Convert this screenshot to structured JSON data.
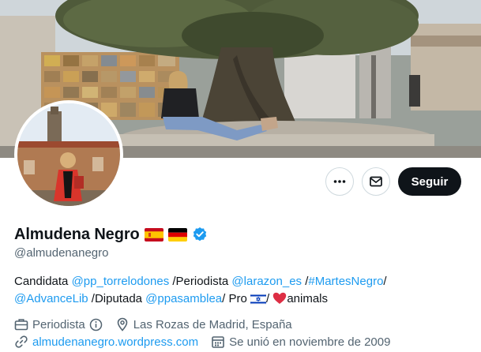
{
  "profile": {
    "name": "Almudena Negro",
    "handle": "@almudenanegro",
    "verified": true,
    "name_flags": [
      "flag-spain",
      "flag-germany"
    ]
  },
  "actions": {
    "more_icon": "more-dots-icon",
    "message_icon": "mail-icon",
    "follow_label": "Seguir"
  },
  "bio": {
    "t1": "Candidata ",
    "l1": "@pp_torrelodones",
    "t2": " /Periodista ",
    "l2": "@larazon_es",
    "t3": " /",
    "l3": "#MartesNegro",
    "t4": "/",
    "l4": "@AdvanceLib",
    "t5": " /Diputada ",
    "l5": "@ppasamblea",
    "t6": "/ Pro ",
    "t7": "/ ",
    "t8": "animals"
  },
  "meta": {
    "category": "Periodista",
    "location": "Las Rozas de Madrid, España",
    "website": "almudenanegro.wordpress.com",
    "joined": "Se unió en noviembre de 2009"
  },
  "colors": {
    "link": "#1d9bf0",
    "follow_bg": "#0f1419",
    "secondary_text": "#536471",
    "verified_badge": "#1d9bf0"
  }
}
